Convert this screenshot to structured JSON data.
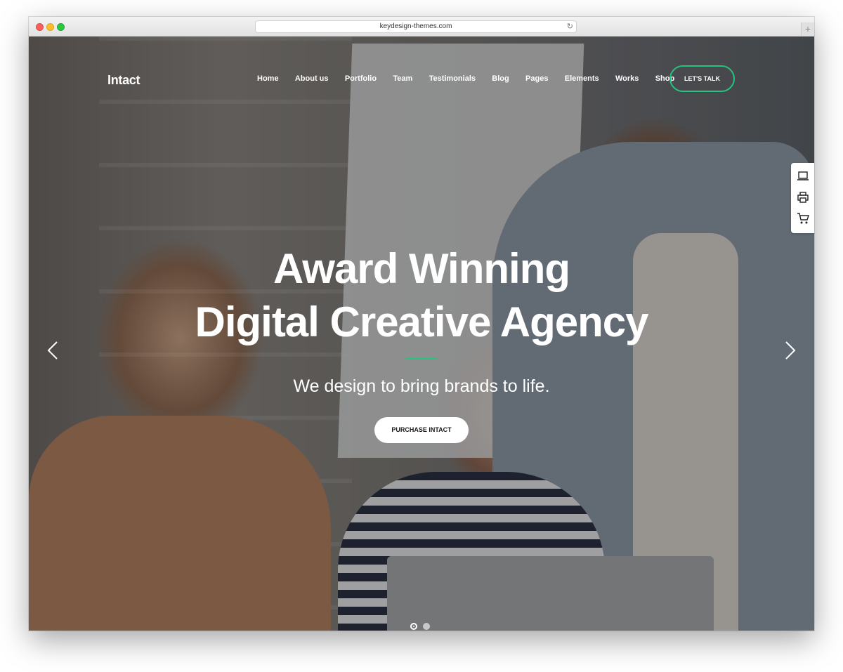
{
  "browser": {
    "url": "keydesign-themes.com",
    "reload_icon": "reload-icon",
    "new_tab_label": "+"
  },
  "header": {
    "logo": "Intact",
    "nav": [
      "Home",
      "About us",
      "Portfolio",
      "Team",
      "Testimonials",
      "Blog",
      "Pages",
      "Elements",
      "Works",
      "Shop"
    ],
    "cta": "LET'S TALK"
  },
  "hero": {
    "headline_line1": "Award Winning",
    "headline_line2": "Digital Creative Agency",
    "tagline": "We design to bring brands to life.",
    "button": "PURCHASE INTACT",
    "slide_count": 2,
    "active_slide": 1
  },
  "side_tools": [
    "laptop-icon",
    "printer-icon",
    "cart-icon"
  ],
  "colors": {
    "accent": "#27c27d",
    "text_light": "#ffffff"
  }
}
